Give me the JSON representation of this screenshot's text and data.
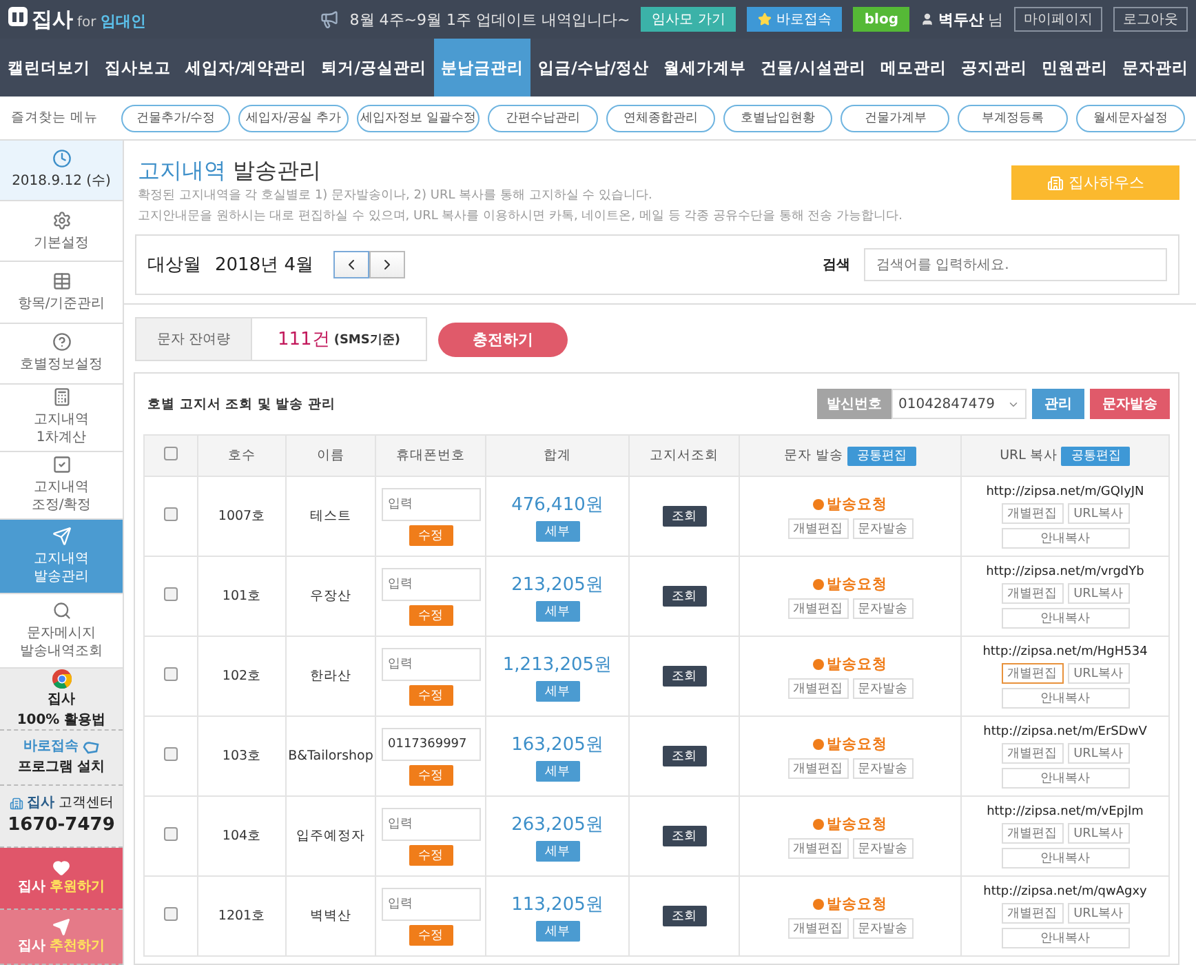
{
  "topbar": {
    "logo": "집사",
    "logo_for": "for",
    "logo_sub": "임대인",
    "notice": "8월 4주~9월 1주 업데이트 내역입니다~",
    "buttons": [
      {
        "label": "임사모 가기",
        "kind": "teal"
      },
      {
        "label": "바로접속",
        "kind": "star"
      },
      {
        "label": "blog",
        "kind": "green"
      }
    ],
    "user": "벽두산",
    "user_suffix": "님",
    "links": [
      "마이페이지",
      "로그아웃"
    ]
  },
  "nav": [
    {
      "label": "캘린더보기",
      "selected": false
    },
    {
      "label": "집사보고",
      "selected": false
    },
    {
      "label": "세입자/계약관리",
      "selected": false
    },
    {
      "label": "퇴거/공실관리",
      "selected": false
    },
    {
      "label": "분납금관리",
      "selected": true
    },
    {
      "label": "입금/수납/정산",
      "selected": false
    },
    {
      "label": "월세가계부",
      "selected": false
    },
    {
      "label": "건물/시설관리",
      "selected": false
    },
    {
      "label": "메모관리",
      "selected": false
    },
    {
      "label": "공지관리",
      "selected": false
    },
    {
      "label": "민원관리",
      "selected": false
    },
    {
      "label": "문자관리",
      "selected": false
    }
  ],
  "favorites": {
    "label": "즐겨찾는 메뉴",
    "items": [
      "건물추가/수정",
      "세입자/공실 추가",
      "세입자정보 일괄수정",
      "간편수납관리",
      "연체종합관리",
      "호별납입현황",
      "건물가계부",
      "부계정등록",
      "월세문자설정"
    ]
  },
  "sidebar": {
    "date": "2018.9.12 (수)",
    "items": [
      {
        "lines": [
          "기본설정"
        ],
        "selected": false
      },
      {
        "lines": [
          "항목/기준관리"
        ],
        "selected": false
      },
      {
        "lines": [
          "호별정보설정"
        ],
        "selected": false
      },
      {
        "lines": [
          "고지내역",
          "1차계산"
        ],
        "selected": false
      },
      {
        "lines": [
          "고지내역",
          "조정/확정"
        ],
        "selected": false
      },
      {
        "lines": [
          "고지내역",
          "발송관리"
        ],
        "selected": true
      },
      {
        "lines": [
          "문자메시지",
          "발송내역조회"
        ],
        "selected": false
      }
    ],
    "promos": [
      {
        "kind": "chrome",
        "lines": [
          "집사",
          "100% 활용법"
        ]
      },
      {
        "kind": "install",
        "lines": [
          "바로접속",
          "프로그램 설치"
        ]
      },
      {
        "kind": "support",
        "lines": [
          "집사",
          "고객센터",
          "1670-7479"
        ]
      },
      {
        "kind": "donate",
        "lines": [
          "집사",
          "후원하기"
        ]
      },
      {
        "kind": "recommend",
        "lines": [
          "집사",
          "추천하기"
        ]
      }
    ]
  },
  "page": {
    "title_accent": "고지내역",
    "title": "발송관리",
    "description": [
      "확정된 고지내역을 각 호실별로 1) 문자발송이나, 2) URL 복사를 통해 고지하실 수 있습니다.",
      "고지안내문을 원하시는 대로 편집하실 수 있으며, URL 복사를 이용하시면 카톡, 네이트온, 메일 등 각종 공유수단을 통해 전송 가능합니다."
    ],
    "house_button": "집사하우스"
  },
  "filter": {
    "label": "대상월",
    "value": "2018년 4월",
    "search_label": "검색",
    "search_placeholder": "검색어를 입력하세요."
  },
  "balance": {
    "label": "문자 잔여량",
    "count": "111건",
    "unit": "(SMS기준)",
    "charge_button": "충전하기"
  },
  "table": {
    "title": "호별 고지서 조회 및 발송 관리",
    "sender_label": "발신번호",
    "sender_value": "01042847479",
    "manage_button": "관리",
    "send_button": "문자발송",
    "all_checked": false,
    "columns": [
      "호수",
      "이름",
      "휴대폰번호",
      "합계",
      "고지서조회",
      "문자 발송",
      "URL 복사"
    ],
    "column_buttons": [
      "공통편집",
      "공통편집"
    ],
    "rows": [
      {
        "unit": "1007호",
        "name": "테스트",
        "phone_placeholder": "입력",
        "edit": "수정",
        "total": "476,410원",
        "detail": "세부",
        "view": "조회",
        "status": "발송요청",
        "sms_buttons": [
          "개별편집",
          "문자발송"
        ],
        "url": "http://zipsa.net/m/GQIyJN",
        "url_buttons": [
          "개별편집",
          "URL복사",
          "안내복사"
        ],
        "checked": false,
        "url_edit_active": false
      },
      {
        "unit": "101호",
        "name": "우장산",
        "phone_placeholder": "입력",
        "edit": "수정",
        "total": "213,205원",
        "detail": "세부",
        "view": "조회",
        "status": "발송요청",
        "sms_buttons": [
          "개별편집",
          "문자발송"
        ],
        "url": "http://zipsa.net/m/vrgdYb",
        "url_buttons": [
          "개별편집",
          "URL복사",
          "안내복사"
        ],
        "checked": false,
        "url_edit_active": false
      },
      {
        "unit": "102호",
        "name": "한라산",
        "phone_placeholder": "입력",
        "edit": "수정",
        "total": "1,213,205원",
        "detail": "세부",
        "view": "조회",
        "status": "발송요청",
        "sms_buttons": [
          "개별편집",
          "문자발송"
        ],
        "url": "http://zipsa.net/m/HgH534",
        "url_buttons": [
          "개별편집",
          "URL복사",
          "안내복사"
        ],
        "checked": false,
        "url_edit_active": true
      },
      {
        "unit": "103호",
        "name": "B&Tailorshop",
        "phone": "0117369997",
        "edit": "수정",
        "total": "163,205원",
        "detail": "세부",
        "view": "조회",
        "status": "발송요청",
        "sms_buttons": [
          "개별편집",
          "문자발송"
        ],
        "url": "http://zipsa.net/m/ErSDwV",
        "url_buttons": [
          "개별편집",
          "URL복사",
          "안내복사"
        ],
        "checked": false,
        "url_edit_active": false
      },
      {
        "unit": "104호",
        "name": "입주예정자",
        "phone_placeholder": "입력",
        "edit": "수정",
        "total": "263,205원",
        "detail": "세부",
        "view": "조회",
        "status": "발송요청",
        "sms_buttons": [
          "개별편집",
          "문자발송"
        ],
        "url": "http://zipsa.net/m/vEpjIm",
        "url_buttons": [
          "개별편집",
          "URL복사",
          "안내복사"
        ],
        "checked": false,
        "url_edit_active": false
      },
      {
        "unit": "1201호",
        "name": "벽벽산",
        "phone_placeholder": "입력",
        "edit": "수정",
        "total": "113,205원",
        "detail": "세부",
        "view": "조회",
        "status": "발송요청",
        "sms_buttons": [
          "개별편집",
          "문자발송"
        ],
        "url": "http://zipsa.net/m/qwAgxy",
        "url_buttons": [
          "개별편집",
          "URL복사",
          "안내복사"
        ],
        "checked": false,
        "url_edit_active": false
      }
    ]
  }
}
